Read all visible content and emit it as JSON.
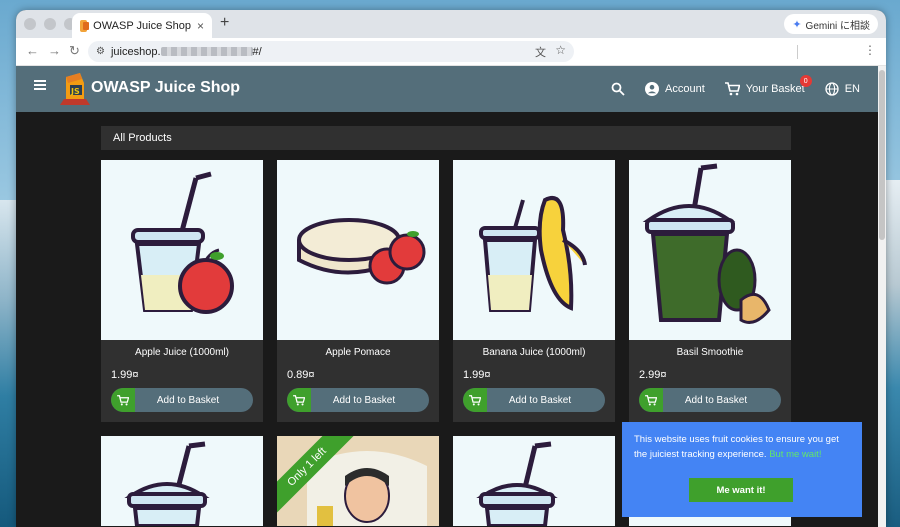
{
  "browser": {
    "tab_title": "OWASP Juice Shop",
    "tab_close": "×",
    "new_tab": "+",
    "url_host": "juiceshop.",
    "url_path": "#/",
    "gemini_label": "Gemini に相談",
    "icons": [
      "back-icon",
      "forward-icon",
      "reload-icon",
      "tune-icon",
      "translate-icon",
      "bookmark-star-icon",
      "more-icon"
    ]
  },
  "app": {
    "brand": "OWASP Juice Shop",
    "account": "Account",
    "basket": "Your Basket",
    "basket_count": "0",
    "language": "EN",
    "toolbar_color": "#546e7a"
  },
  "products": {
    "heading": "All Products",
    "add_label": "Add to Basket",
    "items": [
      {
        "name": "Apple Juice (1000ml)",
        "price": "1.99¤"
      },
      {
        "name": "Apple Pomace",
        "price": "0.89¤"
      },
      {
        "name": "Banana Juice (1000ml)",
        "price": "1.99¤"
      },
      {
        "name": "Basil Smoothie",
        "price": "2.99¤"
      }
    ],
    "ribbon": "Only 1 left"
  },
  "cookie": {
    "text": "This website uses fruit cookies to ensure you get the juiciest tracking experience.",
    "link": "But me wait!",
    "button": "Me want it!"
  }
}
